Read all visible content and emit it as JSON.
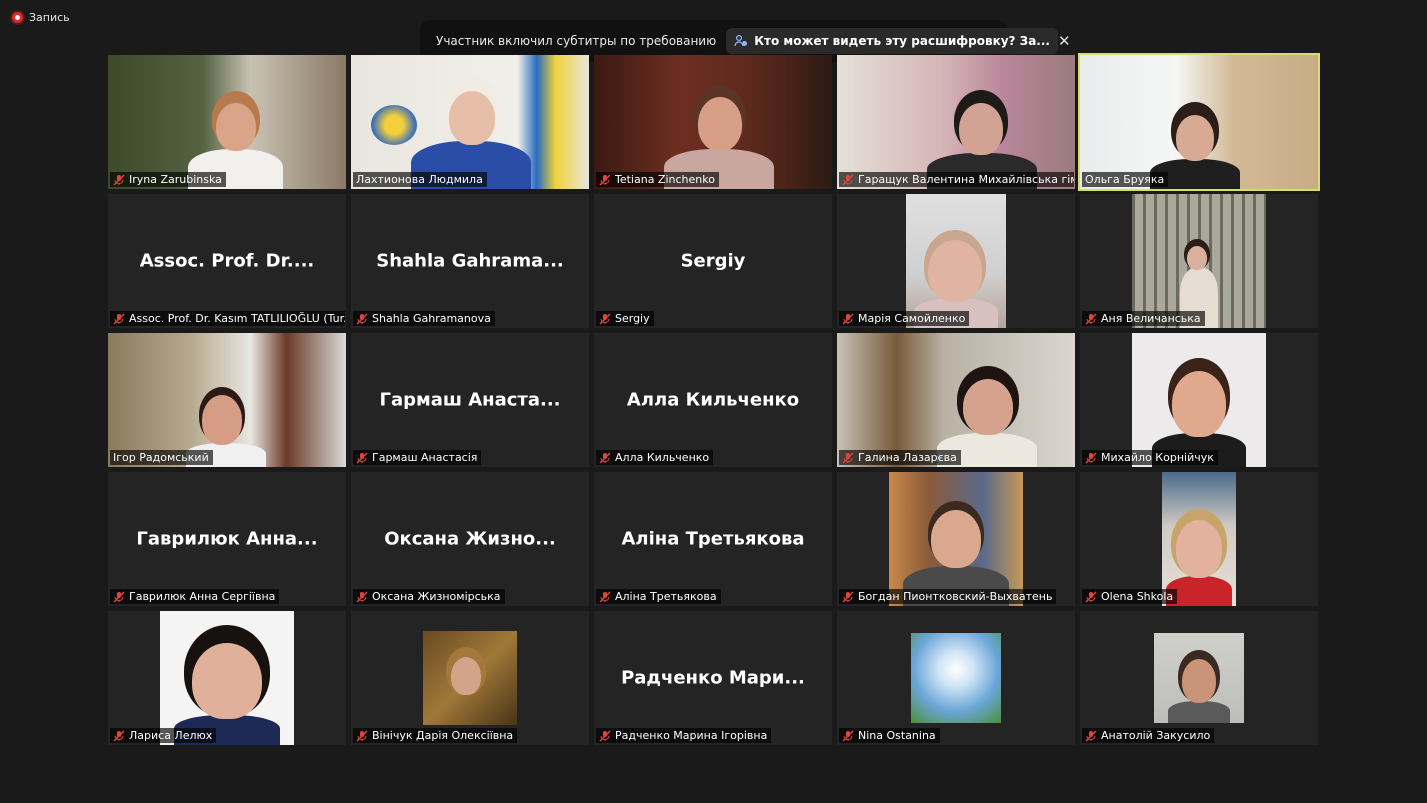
{
  "recording": {
    "label": "Запись"
  },
  "banner": {
    "text": "Участник включил субтитры по требованию",
    "link": "Кто может видеть эту расшифровку? За..."
  },
  "tiles": [
    {
      "name": "Iryna Zarubinska"
    },
    {
      "name": "Лахтионова Людмила"
    },
    {
      "name": "Tetiana Zinchenko"
    },
    {
      "name": "Гаращук Валентина Михайлівська гімн..."
    },
    {
      "name": "Ольга Бруяка"
    },
    {
      "name": "Assoc. Prof. Dr. Kasım TATLILIOĞLU (Tur...",
      "big": "Assoc. Prof. Dr...."
    },
    {
      "name": "Shahla Gahramanova",
      "big": "Shahla  Gahrama..."
    },
    {
      "name": "Sergiy",
      "big": "Sergiy"
    },
    {
      "name": "Марія Самойленко"
    },
    {
      "name": "Аня Величанська"
    },
    {
      "name": "Ігор Радомський"
    },
    {
      "name": "Гармаш Анастасія",
      "big": "Гармаш  Анаста..."
    },
    {
      "name": "Алла Кильченко",
      "big": "Алла Кильченко"
    },
    {
      "name": "Галина Лазарєва"
    },
    {
      "name": "Михайло Корнійчук"
    },
    {
      "name": "Гаврилюк Анна Сергіївна",
      "big": "Гаврилюк  Анна..."
    },
    {
      "name": "Оксана Жизномірська",
      "big": "Оксана  Жизно..."
    },
    {
      "name": "Аліна Третьякова",
      "big": "Аліна Третьякова"
    },
    {
      "name": "Богдан Пионтковский-Выхватень"
    },
    {
      "name": "Olena Shkola"
    },
    {
      "name": "Лариса Лелюх"
    },
    {
      "name": "Вінічук Дарія Олексіївна"
    },
    {
      "name": "Радченко Марина Ігорівна",
      "big": "Радченко  Мари..."
    },
    {
      "name": "Nina Ostanina"
    },
    {
      "name": "Анатолій Закусило"
    }
  ],
  "colors": {
    "active_border": "#d4e06a",
    "muted_mic": "#e0443a"
  }
}
